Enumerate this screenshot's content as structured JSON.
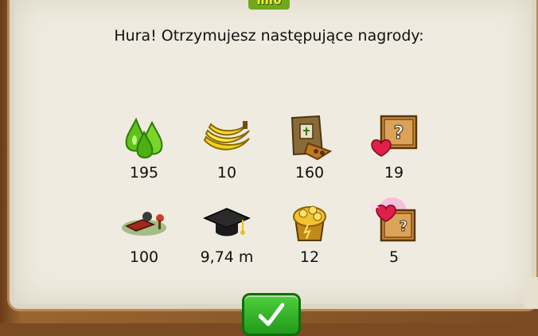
{
  "dialog": {
    "title": "Info",
    "message": "Hura! Otrzymujesz następujące nagrody:"
  },
  "rewards": [
    {
      "icon": "green-drops-icon",
      "value": "195"
    },
    {
      "icon": "bananas-icon",
      "value": "10"
    },
    {
      "icon": "seed-bag-icon",
      "value": "160"
    },
    {
      "icon": "mystery-chest-hearts-icon",
      "value": "19"
    },
    {
      "icon": "decoration-items-icon",
      "value": "100"
    },
    {
      "icon": "graduation-cap-icon",
      "value": "9,74 m"
    },
    {
      "icon": "gold-coins-pot-icon",
      "value": "12"
    },
    {
      "icon": "sparkling-chest-hearts-icon",
      "value": "5"
    }
  ],
  "confirm": {
    "icon": "checkmark-icon"
  }
}
